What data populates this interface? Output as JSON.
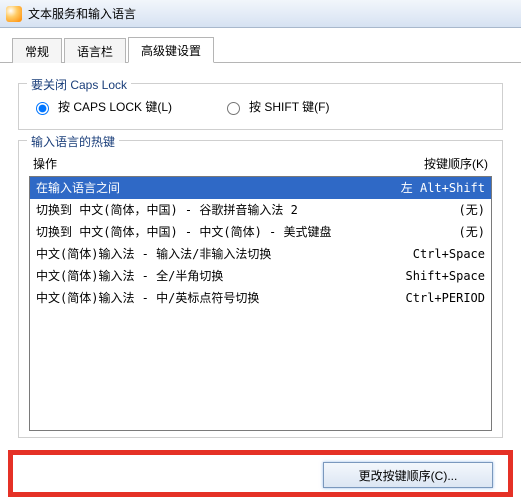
{
  "window": {
    "title": "文本服务和输入语言"
  },
  "tabs": {
    "general": "常规",
    "langbar": "语言栏",
    "advanced": "高级键设置",
    "activeIndex": 2
  },
  "capslock": {
    "legend": "要关闭 Caps Lock",
    "opt_caps": "按 CAPS LOCK 键(L)",
    "opt_shift": "按 SHIFT 键(F)"
  },
  "hotkeys": {
    "legend": "输入语言的热键",
    "header_action": "操作",
    "header_sequence": "按键顺序(K)",
    "rows": [
      {
        "label": "在输入语言之间",
        "seq_prefix": "左",
        "seq": "Alt+Shift",
        "selected": true
      },
      {
        "label": "切换到 中文(简体，中国) - 谷歌拼音输入法 2",
        "seq": "(无)"
      },
      {
        "label": "切换到 中文(简体，中国) - 中文(简体) - 美式键盘",
        "seq": "(无)"
      },
      {
        "label": "中文(简体)输入法 - 输入法/非输入法切换",
        "seq": "Ctrl+Space"
      },
      {
        "label": "中文(简体)输入法 - 全/半角切换",
        "seq": "Shift+Space"
      },
      {
        "label": "中文(简体)输入法 - 中/英标点符号切换",
        "seq": "Ctrl+PERIOD"
      }
    ]
  },
  "buttons": {
    "change_sequence": "更改按键顺序(C)..."
  }
}
